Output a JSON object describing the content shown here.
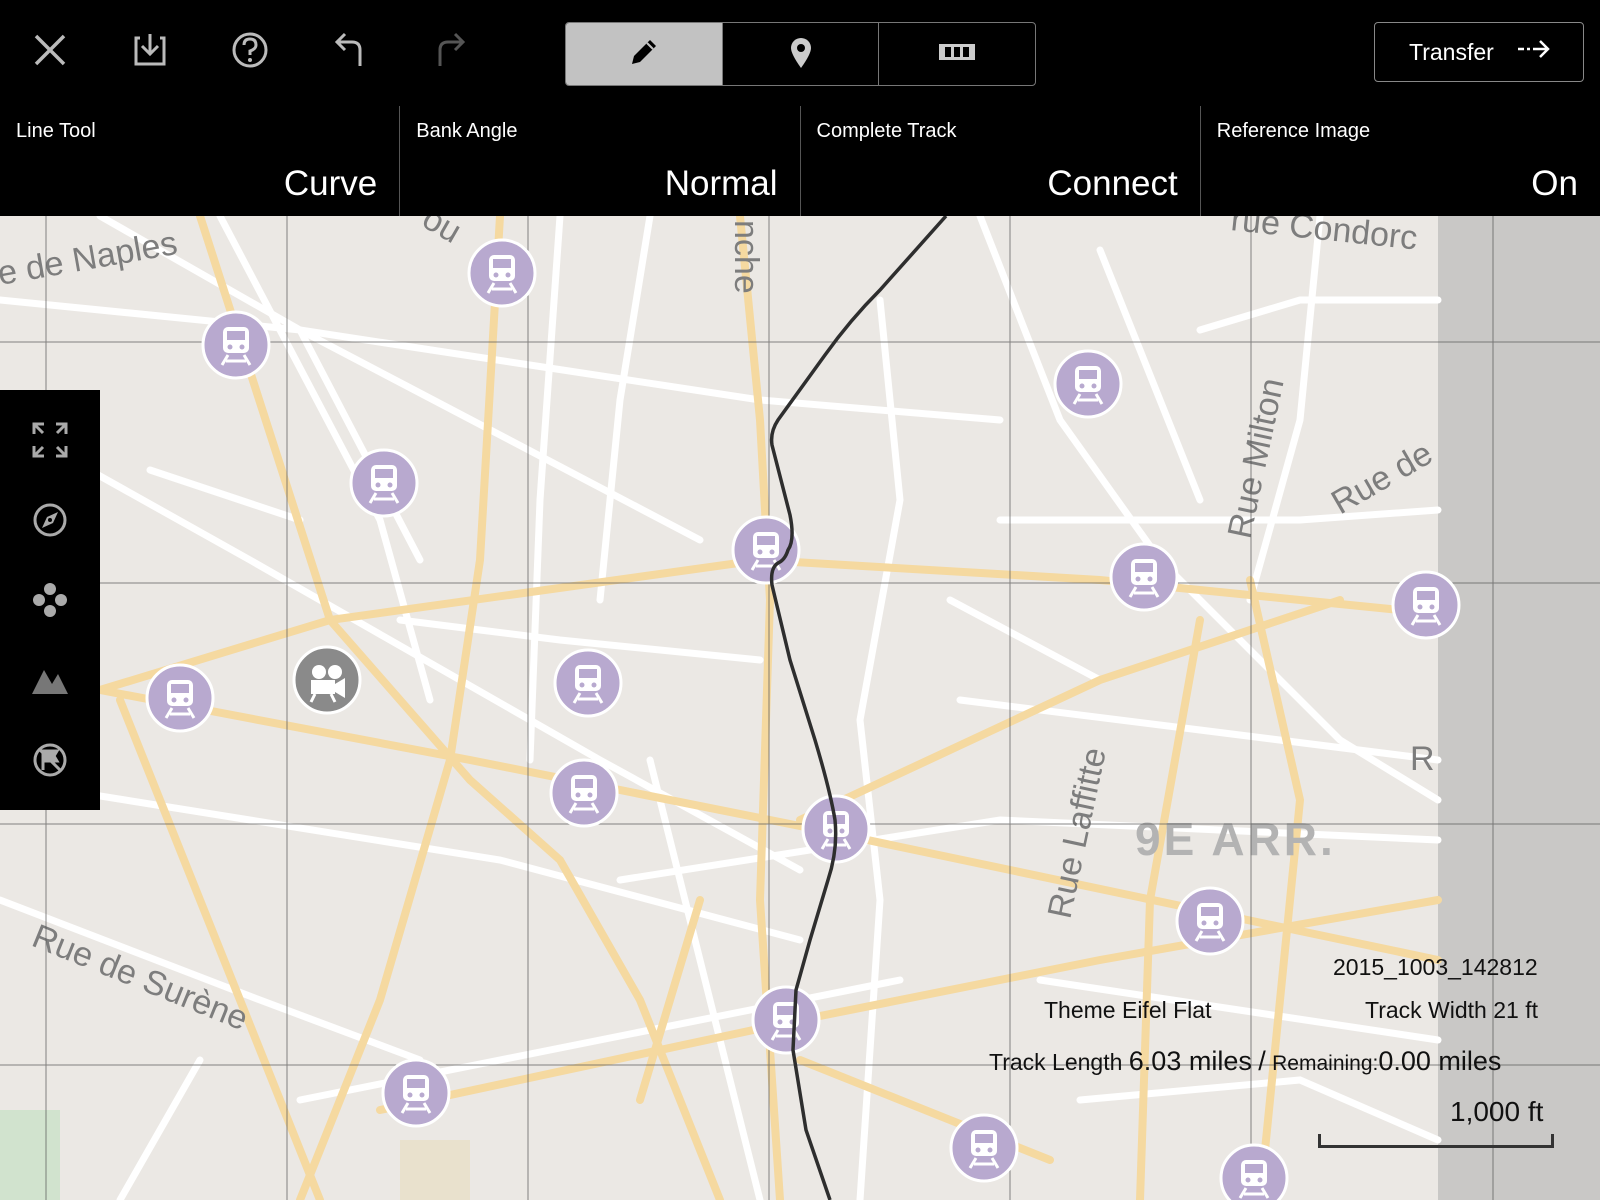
{
  "toolbar": {
    "icons": [
      "close-icon",
      "save-icon",
      "help-icon",
      "undo-icon",
      "redo-icon"
    ],
    "segments": [
      {
        "name": "pencil-icon",
        "active": true
      },
      {
        "name": "location-pin-icon",
        "active": false
      },
      {
        "name": "track-pieces-icon",
        "active": false
      }
    ],
    "transfer_label": "Transfer"
  },
  "settings": [
    {
      "label": "Line Tool",
      "value": "Curve"
    },
    {
      "label": "Bank Angle",
      "value": "Normal"
    },
    {
      "label": "Complete Track",
      "value": "Connect"
    },
    {
      "label": "Reference Image",
      "value": "On"
    }
  ],
  "side_tools": [
    "expand-icon",
    "compass-icon",
    "scatter-icon",
    "terrain-icon",
    "no-flag-icon"
  ],
  "map": {
    "labels": {
      "naples": "e de Naples",
      "surene": "Rue de Surène",
      "laffitte": "Rue Laffitte",
      "milton": "Rue Milton",
      "condorcet": "rue Condorc",
      "rue_de": "Rue de",
      "arr": "9E ARR.",
      "r": "R",
      "lou": "ou",
      "nche": "nche"
    },
    "marker_icons": [
      "train-station-icon",
      "camera-icon"
    ]
  },
  "info": {
    "filename": "2015_1003_142812",
    "theme_label": "Theme",
    "theme_value": "Eifel Flat",
    "track_width_label": "Track Width",
    "track_width_value": "21 ft",
    "track_length_label": "Track Length",
    "track_length_value": "6.03 miles",
    "separator": "/",
    "remaining_label": "Remaining:",
    "remaining_value": "0.00 miles",
    "scale_label": "1,000 ft"
  },
  "colors": {
    "toolbar_bg": "#000000",
    "map_bg": "#ebe8e4",
    "major_road": "#f5d9a0",
    "minor_road": "#ffffff",
    "marker": "#b8a9cf",
    "track": "#2e2e2e",
    "grid": "#555555"
  }
}
